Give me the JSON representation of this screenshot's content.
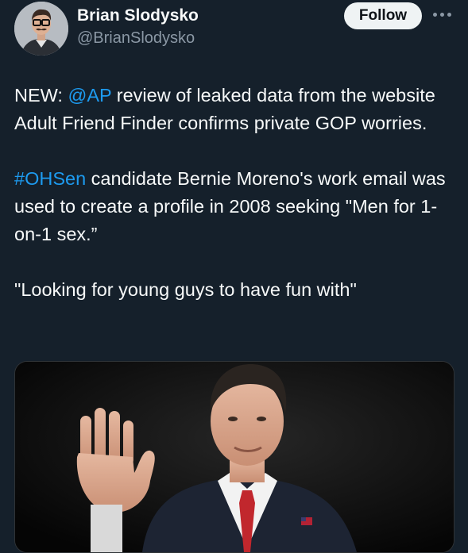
{
  "author": {
    "name": "Brian Slodysko",
    "handle": "@BrianSlodysko"
  },
  "actions": {
    "follow_label": "Follow"
  },
  "tweet": {
    "p1": {
      "prefix": "NEW: ",
      "mention": "@AP",
      "rest": " review of leaked data from the website Adult Friend Finder confirms private GOP worries."
    },
    "p2": {
      "hashtag": "#OHSen",
      "rest": " candidate Bernie Moreno's work email was used to create a profile in 2008 seeking \"Men for 1-on-1 sex.”"
    },
    "p3": {
      "text": "\"Looking for young guys to have fun with\""
    }
  },
  "colors": {
    "background": "#15202b",
    "link": "#1d9bf0",
    "muted": "#8b98a5"
  }
}
